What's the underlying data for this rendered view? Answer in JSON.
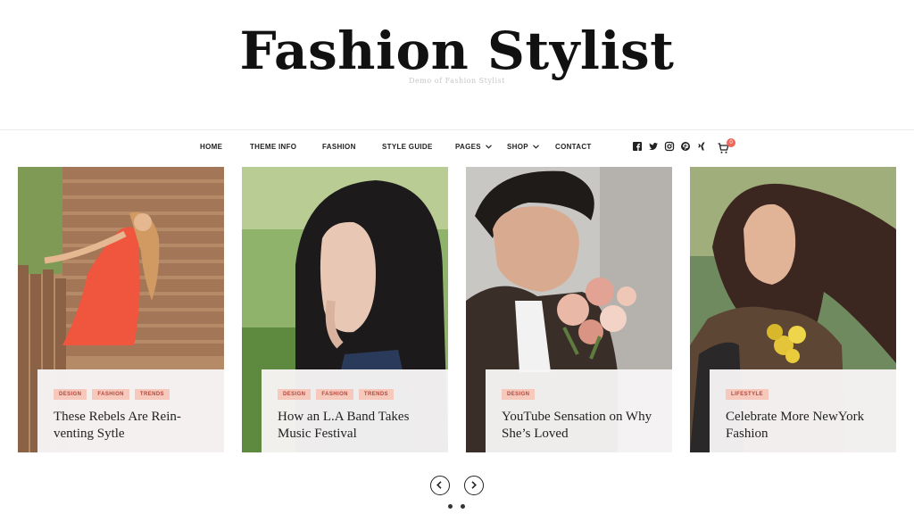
{
  "site": {
    "title": "Fashion Stylist",
    "tagline": "Demo of Fashion Stylist"
  },
  "nav": {
    "items": [
      {
        "label": "HOME"
      },
      {
        "label": "THEME INFO"
      },
      {
        "label": "FASHION"
      },
      {
        "label": "STYLE GUIDE"
      },
      {
        "label": "PAGES",
        "has_dropdown": true
      },
      {
        "label": "SHOP",
        "has_dropdown": true
      },
      {
        "label": "CONTACT"
      }
    ],
    "social": [
      "facebook-icon",
      "twitter-icon",
      "instagram-icon",
      "pinterest-icon",
      "xing-icon"
    ],
    "cart": {
      "icon": "cart-icon",
      "count": "0"
    }
  },
  "colors": {
    "tag_bg": "#f7c9bd",
    "tag_text": "#b3473a",
    "cart_badge": "#f0685a"
  },
  "slides": [
    {
      "tags": [
        "DESIGN",
        "FASHION",
        "TRENDS"
      ],
      "title": "These Rebels Are Rein-venting Sytle",
      "image": "woman-red-dress-photo"
    },
    {
      "tags": [
        "DESIGN",
        "FASHION",
        "TRENDS"
      ],
      "title": "How an L.A Band Takes Music Festival",
      "image": "woman-dark-hair-photo"
    },
    {
      "tags": [
        "DESIGN"
      ],
      "title": "YouTube Sensation on Why She’s Loved",
      "image": "man-with-flowers-photo"
    },
    {
      "tags": [
        "LIFESTYLE"
      ],
      "title": "Celebrate More NewYork Fashion",
      "image": "woman-windblown-hair-photo"
    }
  ],
  "slider_controls": {
    "prev_icon": "chevron-left-icon",
    "next_icon": "chevron-right-icon",
    "dots": 2
  }
}
